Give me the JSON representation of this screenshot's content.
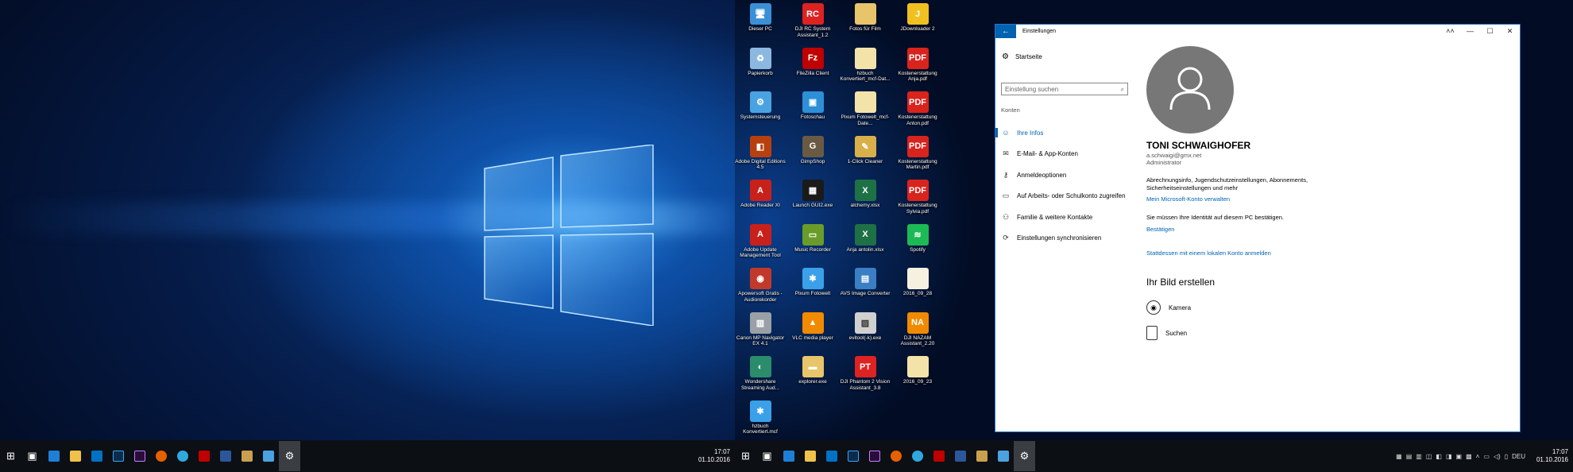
{
  "taskbar_left": {
    "time": "17:07",
    "date": "01.10.2016"
  },
  "taskbar_right": {
    "time": "17:07",
    "date": "01.10.2016",
    "lang": "DEU"
  },
  "desktop_icons": [
    {
      "label": "Dieser PC",
      "icon": "computer-icon",
      "color": "#3b8fd6",
      "glyph": "🖥"
    },
    {
      "label": "DJI RC System Assistant_1.2",
      "icon": "dji-rc-icon",
      "color": "#d22",
      "glyph": "RC"
    },
    {
      "label": "Fotos für Film",
      "icon": "folder-icon",
      "color": "#e8c46a",
      "glyph": ""
    },
    {
      "label": "JDownloader 2",
      "icon": "jdownloader-icon",
      "color": "#f0c020",
      "glyph": "J"
    },
    {
      "label": "Papierkorb",
      "icon": "recycle-bin-icon",
      "color": "#8cb8e0",
      "glyph": "♻"
    },
    {
      "label": "FileZilla Client",
      "icon": "filezilla-icon",
      "color": "#bf0000",
      "glyph": "Fz"
    },
    {
      "label": "hzbuch Konvertiert_mcf-Dat...",
      "icon": "folder-icon",
      "color": "#f3e3a8",
      "glyph": ""
    },
    {
      "label": "Kostenerstattung Anja.pdf",
      "icon": "pdf-icon",
      "color": "#d9231d",
      "glyph": "PDF"
    },
    {
      "label": "Systemsteuerung",
      "icon": "control-panel-icon",
      "color": "#4aa3e0",
      "glyph": "⚙"
    },
    {
      "label": "Fotoschau",
      "icon": "photo-viewer-icon",
      "color": "#2d8fd6",
      "glyph": "▣"
    },
    {
      "label": "Pixum Fotowelt_mcf-Date...",
      "icon": "folder-icon",
      "color": "#f3e3a8",
      "glyph": ""
    },
    {
      "label": "Kostenerstattung Anton.pdf",
      "icon": "pdf-icon",
      "color": "#d9231d",
      "glyph": "PDF"
    },
    {
      "label": "Adobe Digital Editions 4.5",
      "icon": "adobe-de-icon",
      "color": "#b8400f",
      "glyph": "◧"
    },
    {
      "label": "GimpShop",
      "icon": "gimp-icon",
      "color": "#6b5a43",
      "glyph": "G"
    },
    {
      "label": "1-Click Cleaner",
      "icon": "cleaner-icon",
      "color": "#d8b04a",
      "glyph": "✎"
    },
    {
      "label": "Kostenerstattung Martin.pdf",
      "icon": "pdf-icon",
      "color": "#d9231d",
      "glyph": "PDF"
    },
    {
      "label": "Adobe Reader XI",
      "icon": "adobe-reader-icon",
      "color": "#c8201a",
      "glyph": "A"
    },
    {
      "label": "Launch GUI2.exe",
      "icon": "launch-gui-icon",
      "color": "#1a1a1a",
      "glyph": "▦"
    },
    {
      "label": "alchemy.xlsx",
      "icon": "excel-icon",
      "color": "#1e7145",
      "glyph": "X"
    },
    {
      "label": "Kostenerstattung Sylvia.pdf",
      "icon": "pdf-icon",
      "color": "#d9231d",
      "glyph": "PDF"
    },
    {
      "label": "Adobe Update Management Tool",
      "icon": "adobe-update-icon",
      "color": "#c8201a",
      "glyph": "A"
    },
    {
      "label": "Music Recorder",
      "icon": "music-recorder-icon",
      "color": "#6a9c2a",
      "glyph": "▭"
    },
    {
      "label": "Anja antolin.xlsx",
      "icon": "excel-icon",
      "color": "#1e7145",
      "glyph": "X"
    },
    {
      "label": "Spotify",
      "icon": "spotify-icon",
      "color": "#1db954",
      "glyph": "≋"
    },
    {
      "label": "Apowersoft Gratis - Audiorekorder",
      "icon": "apowersoft-icon",
      "color": "#c0392b",
      "glyph": "◉"
    },
    {
      "label": "Pixum Fotowelt",
      "icon": "pixum-icon",
      "color": "#3aa0e8",
      "glyph": "✱"
    },
    {
      "label": "AVS Image Converter",
      "icon": "avs-icon",
      "color": "#3a7fc4",
      "glyph": "▤"
    },
    {
      "label": "2016_09_28",
      "icon": "document-icon",
      "color": "#f5f0e0",
      "glyph": ""
    },
    {
      "label": "Canon MP Navigator EX 4.1",
      "icon": "canon-icon",
      "color": "#9aa0a6",
      "glyph": "▥"
    },
    {
      "label": "VLC media player",
      "icon": "vlc-icon",
      "color": "#f08a00",
      "glyph": "▲"
    },
    {
      "label": "evitool(-k).exe",
      "icon": "evitool-icon",
      "color": "#d0d0d0",
      "glyph": "▨"
    },
    {
      "label": "DJI NAZAM Assistant_2.20",
      "icon": "dji-naza-icon",
      "color": "#f08a00",
      "glyph": "NA"
    },
    {
      "label": "Wondershare Streaming Aud...",
      "icon": "wondershare-icon",
      "color": "#2a8c6a",
      "glyph": "◐"
    },
    {
      "label": "explorer.exe",
      "icon": "explorer-icon",
      "color": "#e8c46a",
      "glyph": "▬"
    },
    {
      "label": "DJI Phantom 2 Vision Assistant_3.8",
      "icon": "dji-phantom-icon",
      "color": "#d22",
      "glyph": "PT"
    },
    {
      "label": "2016_09_23",
      "icon": "document-icon",
      "color": "#f3e3a8",
      "glyph": ""
    },
    {
      "label": "hzbuch Konvertiert.mcf",
      "icon": "mcf-icon",
      "color": "#3aa0e8",
      "glyph": "✱"
    }
  ],
  "settings": {
    "title": "Einstellungen",
    "home": "Startseite",
    "search_placeholder": "Einstellung suchen",
    "group": "Konten",
    "nav": [
      {
        "label": "Ihre Infos",
        "icon": "person-icon",
        "glyph": "☺",
        "selected": true
      },
      {
        "label": "E-Mail- & App-Konten",
        "icon": "mail-icon",
        "glyph": "✉",
        "selected": false
      },
      {
        "label": "Anmeldeoptionen",
        "icon": "key-icon",
        "glyph": "⚷",
        "selected": false
      },
      {
        "label": "Auf Arbeits- oder Schulkonto zugreifen",
        "icon": "briefcase-icon",
        "glyph": "▭",
        "selected": false
      },
      {
        "label": "Familie & weitere Kontakte",
        "icon": "people-icon",
        "glyph": "⚇",
        "selected": false
      },
      {
        "label": "Einstellungen synchronisieren",
        "icon": "sync-icon",
        "glyph": "⟳",
        "selected": false
      }
    ],
    "user_name": "TONI SCHWAIGHOFER",
    "user_email": "a.schwaigi@gmx.net",
    "user_role": "Administrator",
    "info_text": "Abrechnungsinfo, Jugendschutzeinstellungen, Abonnements, Sicherheitseinstellungen und mehr",
    "ms_link": "Mein Microsoft-Konto verwalten",
    "verify_text": "Sie müssen Ihre Identität auf diesem PC bestätigen.",
    "verify_link": "Bestätigen",
    "local_link": "Stattdessen mit einem lokalen Konto anmelden",
    "picture_heading": "Ihr Bild erstellen",
    "options": [
      {
        "label": "Kamera",
        "icon": "camera-icon"
      },
      {
        "label": "Suchen",
        "icon": "browse-icon"
      }
    ]
  },
  "colors": {
    "accent": "#0063b1"
  }
}
